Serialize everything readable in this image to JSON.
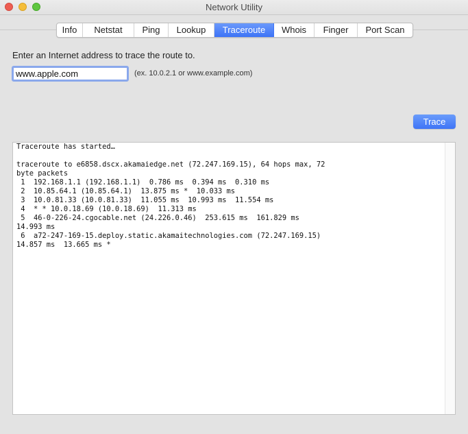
{
  "window": {
    "title": "Network Utility",
    "traffic_lights": [
      "close",
      "minimize",
      "zoom"
    ]
  },
  "tabs": [
    {
      "label": "Info",
      "active": false
    },
    {
      "label": "Netstat",
      "active": false
    },
    {
      "label": "Ping",
      "active": false
    },
    {
      "label": "Lookup",
      "active": false
    },
    {
      "label": "Traceroute",
      "active": true
    },
    {
      "label": "Whois",
      "active": false
    },
    {
      "label": "Finger",
      "active": false
    },
    {
      "label": "Port Scan",
      "active": false
    }
  ],
  "traceroute": {
    "prompt": "Enter an Internet address to trace the route to.",
    "address_value": "www.apple.com",
    "hint": "(ex. 10.0.2.1 or www.example.com)",
    "trace_button": "Trace",
    "output_lines": [
      "Traceroute has started…",
      "",
      "traceroute to e6858.dscx.akamaiedge.net (72.247.169.15), 64 hops max, 72",
      "byte packets",
      " 1  192.168.1.1 (192.168.1.1)  0.786 ms  0.394 ms  0.310 ms",
      " 2  10.85.64.1 (10.85.64.1)  13.875 ms *  10.033 ms",
      " 3  10.0.81.33 (10.0.81.33)  11.055 ms  10.993 ms  11.554 ms",
      " 4  * * 10.0.18.69 (10.0.18.69)  11.313 ms",
      " 5  46-0-226-24.cgocable.net (24.226.0.46)  253.615 ms  161.829 ms",
      "14.993 ms",
      " 6  a72-247-169-15.deploy.static.akamaitechnologies.com (72.247.169.15)",
      "14.857 ms  13.665 ms *"
    ]
  },
  "colors": {
    "accent": "#3d73f6",
    "window_bg": "#e3e3e3",
    "focus_ring": "#8aa8ec"
  }
}
